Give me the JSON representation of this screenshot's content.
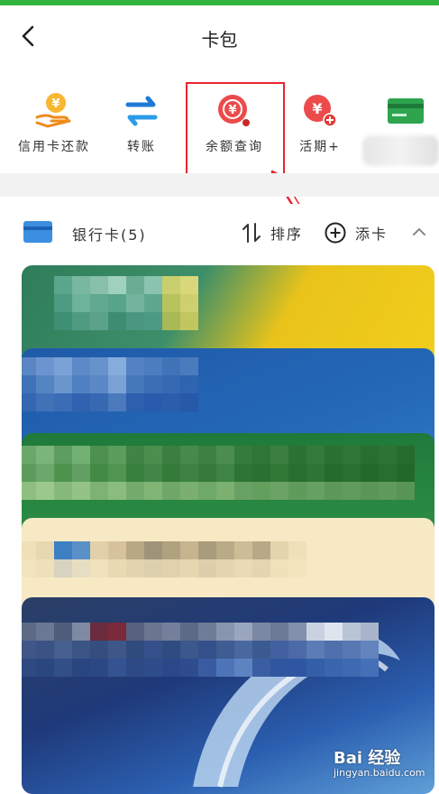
{
  "header": {
    "title": "卡包"
  },
  "shortcuts": [
    {
      "label": "信用卡还款",
      "icon": "hand-coin-icon"
    },
    {
      "label": "转账",
      "icon": "transfer-arrows-icon"
    },
    {
      "label": "余额查询",
      "icon": "balance-search-icon"
    },
    {
      "label": "活期+",
      "icon": "yuan-plus-icon"
    },
    {
      "label": "",
      "icon": "green-card-icon"
    }
  ],
  "section": {
    "title": "银行卡(5)",
    "sort_label": "排序",
    "add_label": "添卡"
  },
  "watermark": {
    "text": "Bai 经验",
    "sub": "jingyan.baidu.com"
  },
  "colors": {
    "brand_green": "#33b43f",
    "highlight_red": "#e8262f",
    "icon_orange": "#f5a623",
    "icon_blue": "#1f7ad6",
    "icon_red": "#ec4b4b"
  }
}
